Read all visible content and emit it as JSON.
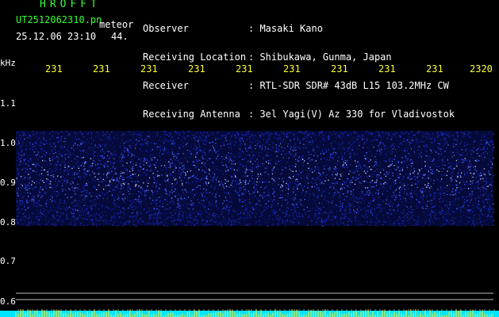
{
  "header": {
    "app_title": "HROFFT",
    "file_name": "UT2512062310.pn",
    "mode": "meteor",
    "datetime": "25.12.06 23:10",
    "count": "44.",
    "info": [
      {
        "label": "Observer",
        "value": ": Masaki Kano"
      },
      {
        "label": "Receiving Location",
        "value": ": Shibukawa, Gunma, Japan"
      },
      {
        "label": "Receiver",
        "value": ": RTL-SDR SDR# 43dB L15 103.2MHz CW"
      },
      {
        "label": "Receiving Antenna",
        "value": ": 3el Yagi(V) Az 330 for Vladivostok"
      }
    ]
  },
  "axis": {
    "unit": "kHz",
    "time_ticks": [
      "231",
      "231",
      "231",
      "231",
      "231",
      "231",
      "231",
      "231",
      "231",
      "2320"
    ],
    "freq_ticks": [
      "1.1",
      "1.0",
      "0.9",
      "0.8",
      "0.7",
      "0.6"
    ]
  },
  "colors": {
    "background": "#000000",
    "title_green": "#33ff33",
    "tick_yellow": "#ffff33",
    "signal_blue": "#1a2bd6",
    "baseline_cyan": "#00ffff"
  }
}
